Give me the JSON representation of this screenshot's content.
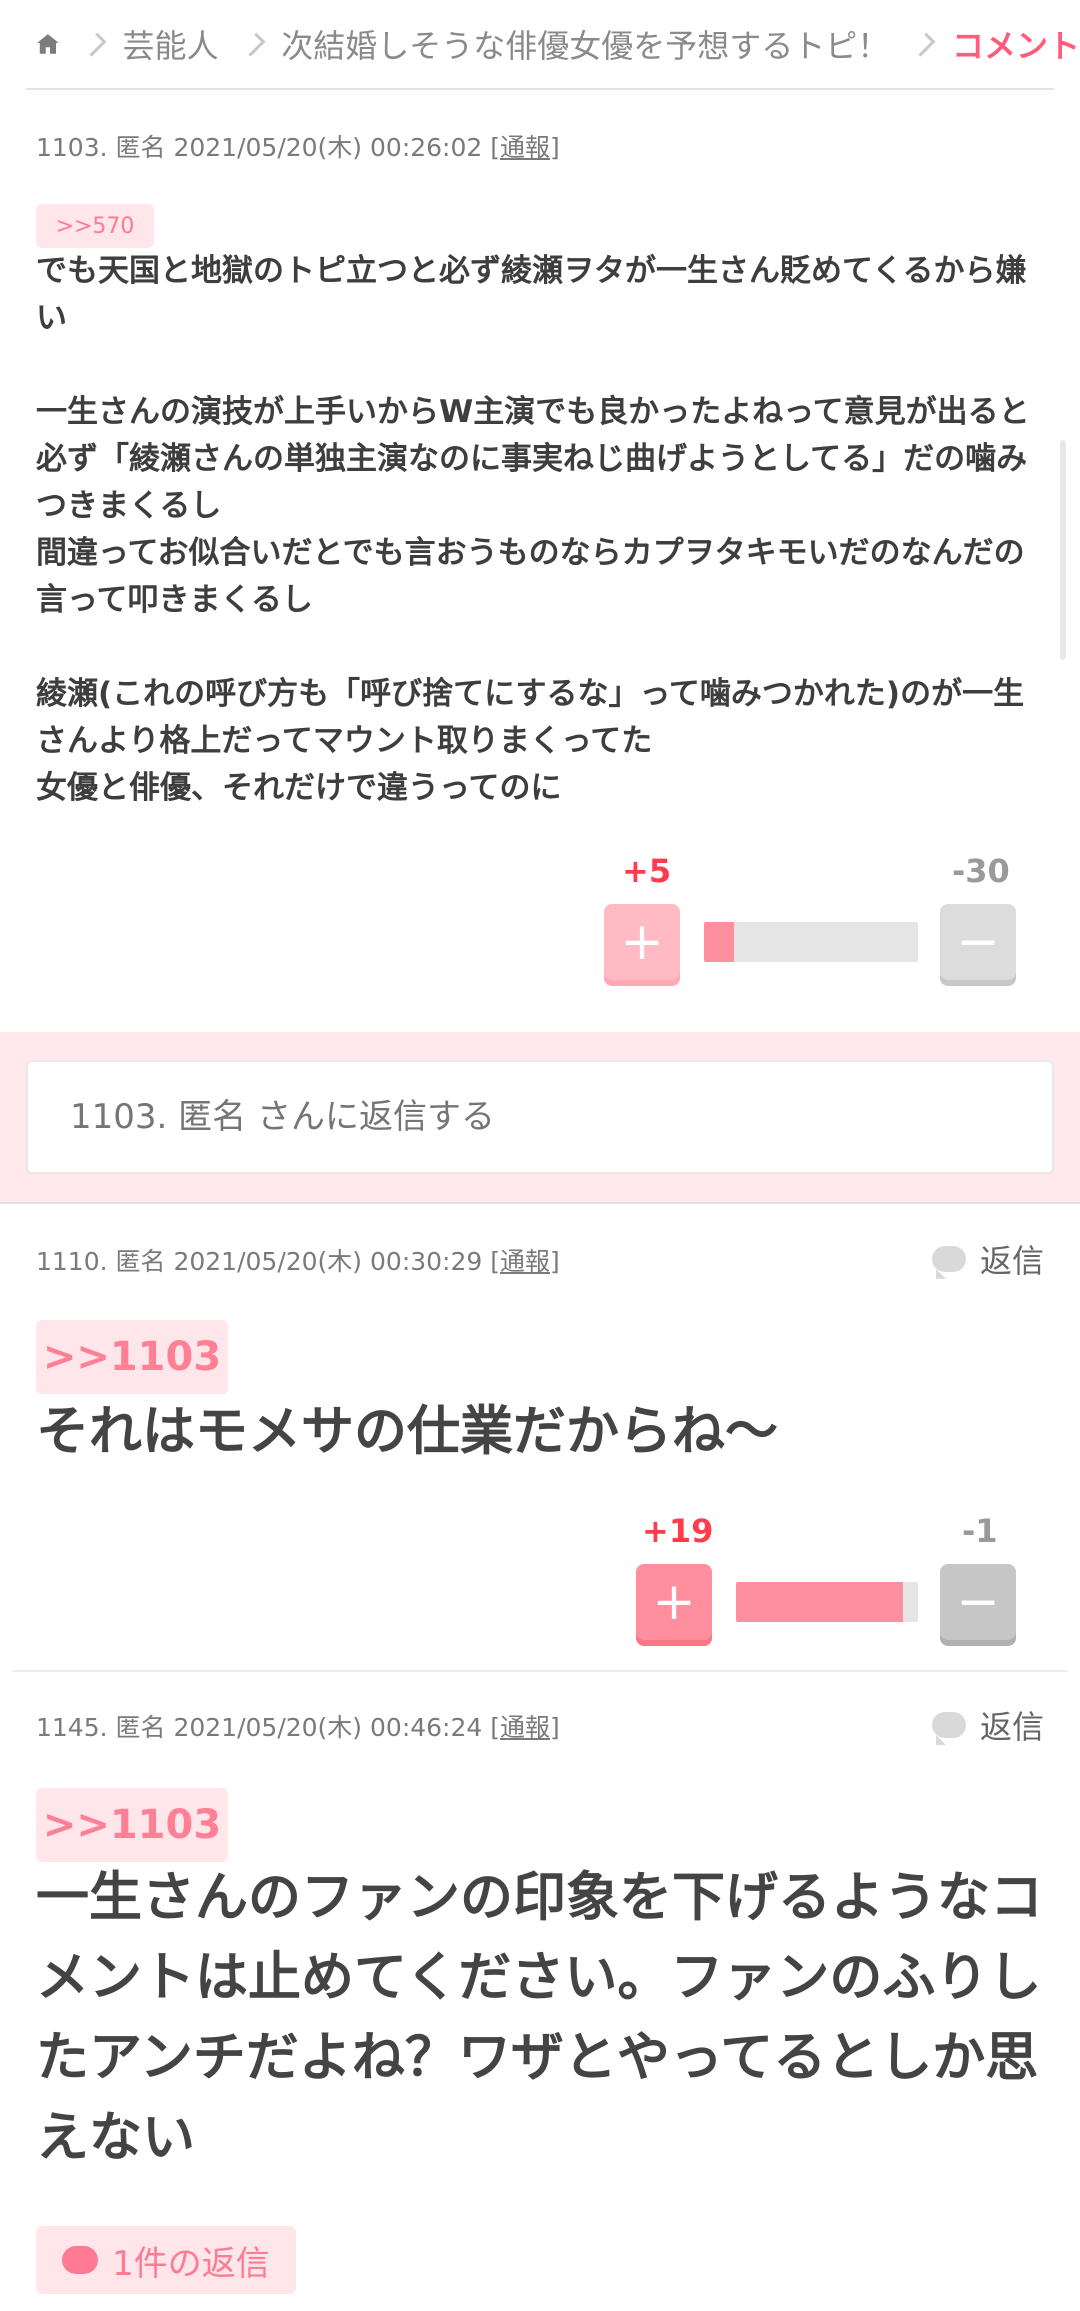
{
  "breadcrumb": {
    "items": [
      "芸能人",
      "次結婚しそうな俳優女優を予想するトピ！"
    ],
    "current": "コメント"
  },
  "comments": [
    {
      "meta": "1103. 匿名 2021/05/20(木) 00:26:02",
      "report": "通報",
      "anchor": ">>570",
      "paragraphs": [
        "でも天国と地獄のトピ立つと必ず綾瀬ヲタが一生さん貶めてくるから嫌い",
        "",
        "一生さんの演技が上手いからW主演でも良かったよねって意見が出ると必ず「綾瀬さんの単独主演なのに事実ねじ曲げようとしてる」だの噛みつきまくるし",
        "間違ってお似合いだとでも言おうものならカプヲタキモいだのなんだの言って叩きまくるし",
        "",
        "綾瀬(これの呼び方も「呼び捨てにするな」って噛みつかれた)のが一生さんより格上だってマウント取りまくってた",
        "女優と俳優、それだけで違うってのに"
      ],
      "plus": "+5",
      "minus": "-30",
      "plus_ratio": 0.14
    },
    {
      "meta": "1110. 匿名 2021/05/20(木) 00:30:29",
      "report": "通報",
      "reply_label": "返信",
      "anchor": ">>1103",
      "text": "それはモメサの仕業だからね〜",
      "plus": "+19",
      "minus": "-1",
      "plus_ratio": 0.92
    },
    {
      "meta": "1145. 匿名 2021/05/20(木) 00:46:24",
      "report": "通報",
      "reply_label": "返信",
      "anchor": ">>1103",
      "text": "一生さんのファンの印象を下げるようなコメントは止めてください。ファンのふりしたアンチだよね？ワザとやってるとしか思えない",
      "replies_count_label": "1件の返信"
    }
  ],
  "reply_box": {
    "placeholder": "1103. 匿名 さんに返信する"
  },
  "icons": {
    "home": "home-icon",
    "reply": "speech-bubble-icon"
  },
  "colors": {
    "accent": "#ff5c7c",
    "plus": "#ff8e9e",
    "minus": "#c8c8c8"
  }
}
